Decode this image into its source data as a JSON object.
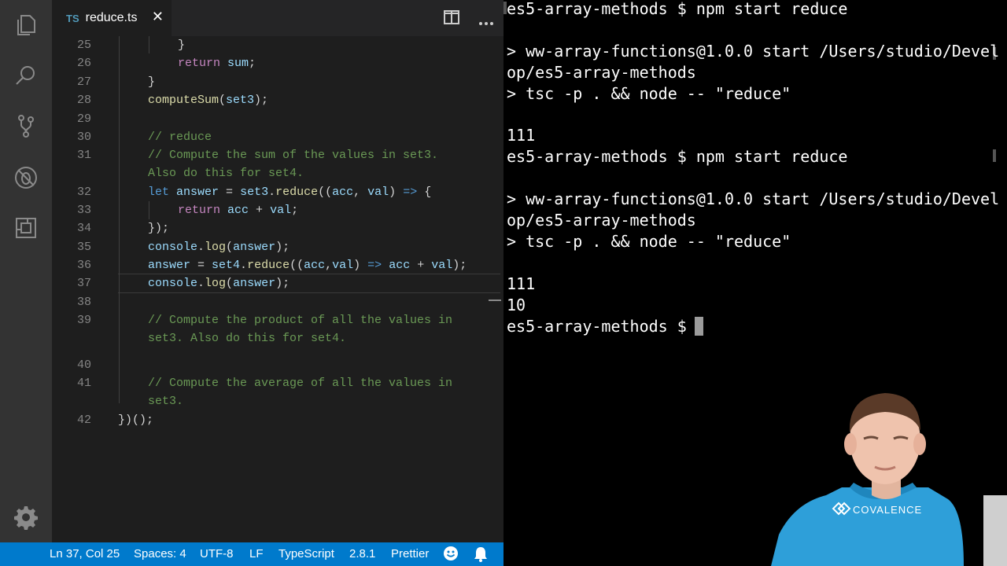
{
  "editor": {
    "tab": {
      "lang_badge": "TS",
      "filename": "reduce.ts",
      "close": "✕"
    },
    "lines": [
      {
        "n": "25",
        "indent": 160,
        "tokens": [
          [
            "p",
            "}"
          ]
        ]
      },
      {
        "n": "26",
        "indent": 160,
        "tokens": [
          [
            "k",
            "return"
          ],
          [
            "p",
            " "
          ],
          [
            "v",
            "sum"
          ],
          [
            "p",
            ";"
          ]
        ]
      },
      {
        "n": "27",
        "indent": 122,
        "tokens": [
          [
            "p",
            "}"
          ]
        ]
      },
      {
        "n": "28",
        "indent": 122,
        "tokens": [
          [
            "f",
            "computeSum"
          ],
          [
            "p",
            "("
          ],
          [
            "v",
            "set3"
          ],
          [
            "p",
            ");"
          ]
        ]
      },
      {
        "n": "29",
        "indent": 122,
        "tokens": []
      },
      {
        "n": "30",
        "indent": 122,
        "tokens": [
          [
            "c",
            "// reduce"
          ]
        ]
      },
      {
        "n": "31",
        "indent": 122,
        "tokens": [
          [
            "c",
            "// Compute the sum of the values in set3."
          ]
        ]
      },
      {
        "n": "",
        "indent": 122,
        "tokens": [
          [
            "c",
            "Also do this for set4."
          ]
        ]
      },
      {
        "n": "32",
        "indent": 122,
        "tokens": [
          [
            "kb",
            "let"
          ],
          [
            "p",
            " "
          ],
          [
            "v",
            "answer"
          ],
          [
            "p",
            " = "
          ],
          [
            "v",
            "set3"
          ],
          [
            "p",
            "."
          ],
          [
            "f",
            "reduce"
          ],
          [
            "p",
            "(("
          ],
          [
            "v",
            "acc"
          ],
          [
            "p",
            ", "
          ],
          [
            "v",
            "val"
          ],
          [
            "p",
            ") "
          ],
          [
            "kb",
            "=>"
          ],
          [
            "p",
            " {"
          ]
        ]
      },
      {
        "n": "33",
        "indent": 160,
        "tokens": [
          [
            "k",
            "return"
          ],
          [
            "p",
            " "
          ],
          [
            "v",
            "acc"
          ],
          [
            "p",
            " + "
          ],
          [
            "v",
            "val"
          ],
          [
            "p",
            ";"
          ]
        ]
      },
      {
        "n": "34",
        "indent": 122,
        "tokens": [
          [
            "p",
            "});"
          ]
        ]
      },
      {
        "n": "35",
        "indent": 122,
        "tokens": [
          [
            "v",
            "console"
          ],
          [
            "p",
            "."
          ],
          [
            "f",
            "log"
          ],
          [
            "p",
            "("
          ],
          [
            "v",
            "answer"
          ],
          [
            "p",
            ");"
          ]
        ]
      },
      {
        "n": "36",
        "indent": 122,
        "tokens": [
          [
            "v",
            "answer"
          ],
          [
            "p",
            " = "
          ],
          [
            "v",
            "set4"
          ],
          [
            "p",
            "."
          ],
          [
            "f",
            "reduce"
          ],
          [
            "p",
            "(("
          ],
          [
            "v",
            "acc"
          ],
          [
            "p",
            ","
          ],
          [
            "v",
            "val"
          ],
          [
            "p",
            ") "
          ],
          [
            "kb",
            "=>"
          ],
          [
            "p",
            " "
          ],
          [
            "v",
            "acc"
          ],
          [
            "p",
            " + "
          ],
          [
            "v",
            "val"
          ],
          [
            "p",
            ");"
          ]
        ]
      },
      {
        "n": "37",
        "indent": 122,
        "tokens": [
          [
            "v",
            "console"
          ],
          [
            "p",
            "."
          ],
          [
            "f",
            "log"
          ],
          [
            "p",
            "("
          ],
          [
            "v",
            "answer"
          ],
          [
            "p",
            ");"
          ]
        ]
      },
      {
        "n": "38",
        "indent": 122,
        "tokens": []
      },
      {
        "n": "39",
        "indent": 122,
        "tokens": [
          [
            "c",
            "// Compute the product of all the values in"
          ]
        ]
      },
      {
        "n": "",
        "indent": 122,
        "tokens": [
          [
            "c",
            "set3. Also do this for set4."
          ]
        ]
      },
      {
        "n": "40",
        "indent": 122,
        "tokens": []
      },
      {
        "n": "41",
        "indent": 122,
        "tokens": [
          [
            "c",
            "// Compute the average of all the values in"
          ]
        ]
      },
      {
        "n": "",
        "indent": 122,
        "tokens": [
          [
            "c",
            "set3."
          ]
        ]
      },
      {
        "n": "42",
        "indent": 84,
        "tokens": [
          [
            "p",
            "})();"
          ]
        ]
      }
    ]
  },
  "status_bar": {
    "position": "Ln 37, Col 25",
    "spaces": "Spaces: 4",
    "encoding": "UTF-8",
    "eol": "LF",
    "language": "TypeScript",
    "ts_version": "2.8.1",
    "formatter": "Prettier"
  },
  "terminal": {
    "lines": [
      "es5-array-methods $ npm start reduce",
      "",
      "> ww-array-functions@1.0.0 start /Users/studio/Devel",
      "op/es5-array-methods",
      "> tsc -p . && node -- \"reduce\"",
      "",
      "111",
      "es5-array-methods $ npm start reduce",
      "",
      "> ww-array-functions@1.0.0 start /Users/studio/Devel",
      "op/es5-array-methods",
      "> tsc -p . && node -- \"reduce\"",
      "",
      "111",
      "10",
      "es5-array-methods $ "
    ]
  },
  "webcam": {
    "shirt_logo": "COVALENCE"
  },
  "colors": {
    "status_bar": "#007acc",
    "activity_bar": "#333333",
    "editor_bg": "#1e1e1e",
    "terminal_bg": "#000000",
    "shirt": "#2e9fd9"
  },
  "icons": [
    "explorer-icon",
    "search-icon",
    "source-control-icon",
    "debug-icon",
    "extensions-icon",
    "settings-gear-icon",
    "split-editor-icon",
    "more-actions-icon",
    "smiley-feedback-icon",
    "bell-icon"
  ]
}
